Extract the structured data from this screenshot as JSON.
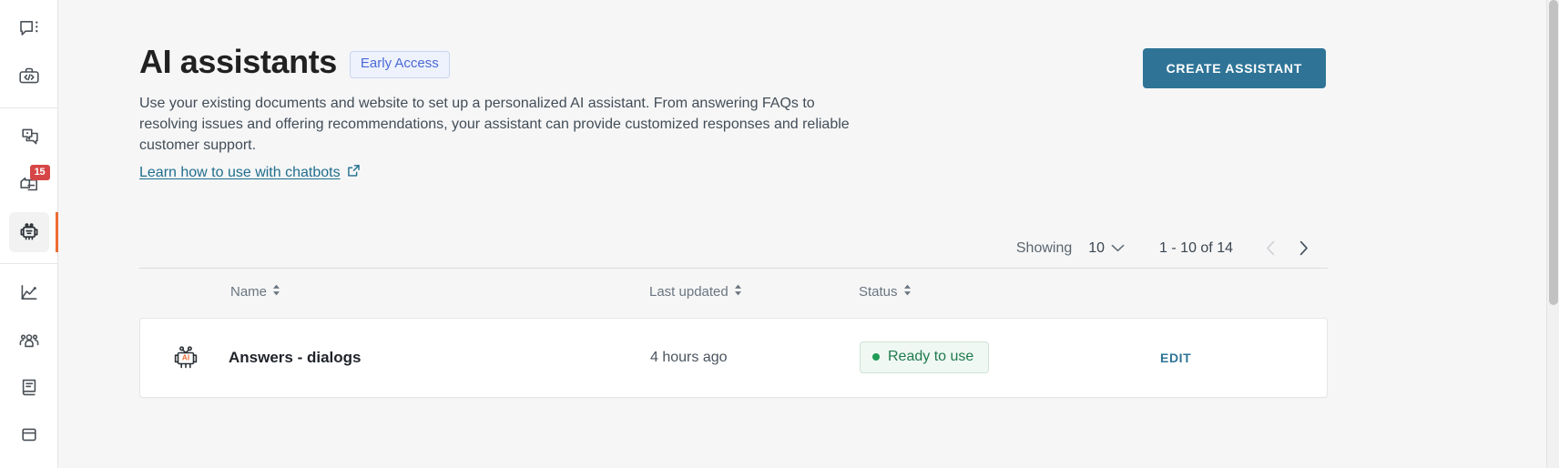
{
  "sidebar": {
    "groups": [
      {
        "items": [
          {
            "id": "chats",
            "icon": "chat-bubble-icon",
            "label": "Chats",
            "badge": null,
            "active": false
          },
          {
            "id": "developer",
            "icon": "code-toolbox-icon",
            "label": "Developer tools",
            "badge": null,
            "active": false
          }
        ]
      },
      {
        "items": [
          {
            "id": "knowledge",
            "icon": "knowledge-cards-icon",
            "label": "Knowledge",
            "badge": null,
            "active": false
          },
          {
            "id": "tickets",
            "icon": "ticket-icon",
            "label": "Tickets",
            "badge": "15",
            "active": false
          },
          {
            "id": "ai-assistants",
            "icon": "robot-icon",
            "label": "AI assistants",
            "badge": null,
            "active": true
          }
        ]
      },
      {
        "items": [
          {
            "id": "reports",
            "icon": "chart-line-icon",
            "label": "Reports",
            "badge": null,
            "active": false
          },
          {
            "id": "team",
            "icon": "team-people-icon",
            "label": "Team",
            "badge": null,
            "active": false
          },
          {
            "id": "articles",
            "icon": "book-icon",
            "label": "Articles",
            "badge": null,
            "active": false
          },
          {
            "id": "more",
            "icon": "panel-icon",
            "label": "More",
            "badge": null,
            "active": false
          }
        ]
      }
    ]
  },
  "header": {
    "title": "AI assistants",
    "badge": "Early Access",
    "description": "Use your existing documents and website to set up a personalized AI assistant. From answering FAQs to resolving issues and offering recommendations, your assistant can provide customized responses and reliable customer support.",
    "link_label": "Learn how to use with chatbots",
    "link_icon": "external-link-icon",
    "create_button": "CREATE ASSISTANT"
  },
  "pagination": {
    "showing_label": "Showing",
    "page_size": "10",
    "chevron_icon": "chevron-down-icon",
    "range": "1 - 10 of 14",
    "prev_icon": "chevron-left-icon",
    "next_icon": "chevron-right-icon"
  },
  "table": {
    "columns": [
      {
        "key": "name",
        "label": "Name",
        "sort_icon": "sort-arrows-icon"
      },
      {
        "key": "last_updated",
        "label": "Last updated",
        "sort_icon": "sort-arrows-icon"
      },
      {
        "key": "status",
        "label": "Status",
        "sort_icon": "sort-arrows-icon"
      },
      {
        "key": "actions",
        "label": ""
      }
    ],
    "rows": [
      {
        "icon": "ai-robot-icon",
        "icon_text": "AI",
        "name": "Answers - dialogs",
        "last_updated": "4 hours ago",
        "status": "Ready to use",
        "status_dot_color": "#1f9d55",
        "action": "EDIT"
      }
    ]
  },
  "colors": {
    "accent": "#2f7497",
    "active_marker": "#ee6d31",
    "badge_red": "#d64646",
    "early_access_text": "#4a69d6",
    "status_green": "#1f7a4d"
  }
}
